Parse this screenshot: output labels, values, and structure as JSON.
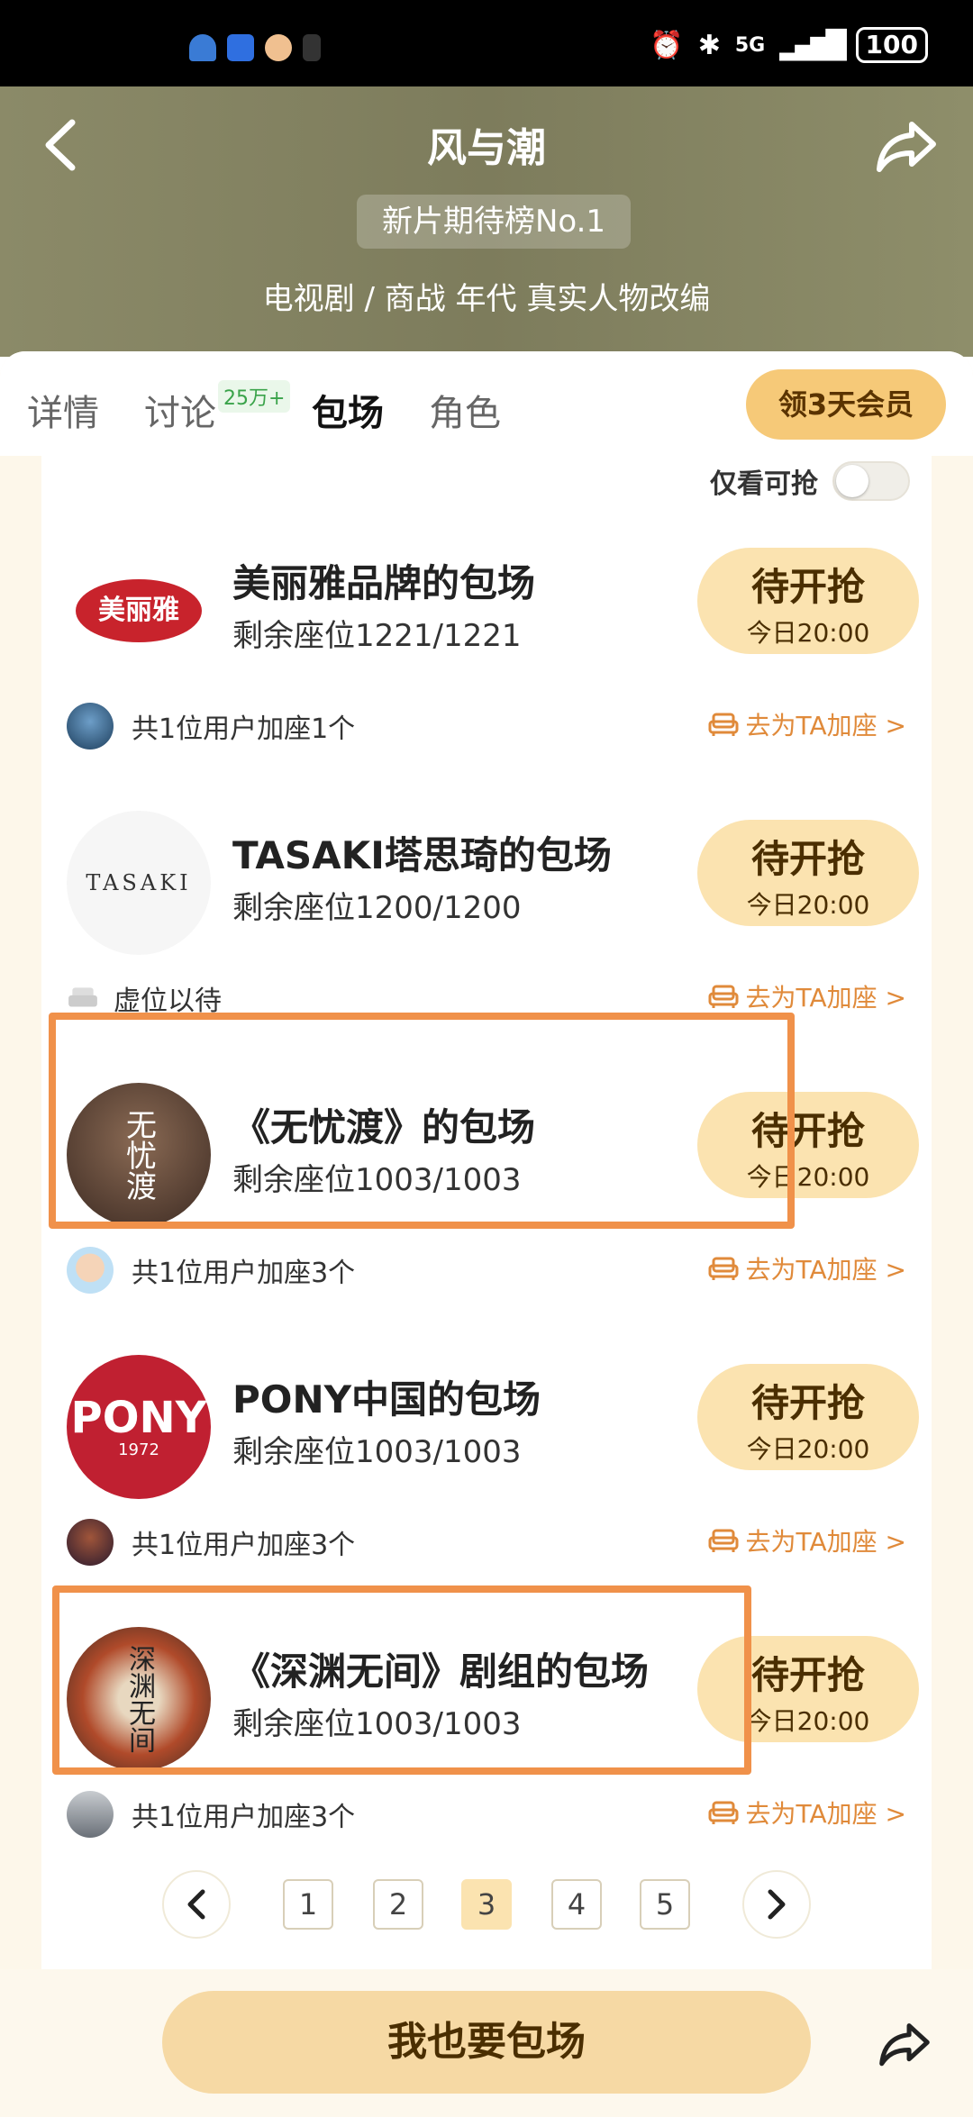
{
  "status_bar": {
    "network": "5G",
    "battery": "100"
  },
  "header": {
    "title": "风与潮",
    "rank_chip": "新片期待榜No.1",
    "genre": "电视剧 / 商战 年代 真实人物改编"
  },
  "tabs": [
    {
      "label": "详情",
      "active": false
    },
    {
      "label": "讨论",
      "badge": "25万+",
      "active": false
    },
    {
      "label": "包场",
      "active": true
    },
    {
      "label": "角色",
      "active": false
    }
  ],
  "vip_button": "领3天会员",
  "filter": {
    "label": "仅看可抢",
    "on": false
  },
  "items": [
    {
      "logo_text": "美丽雅",
      "title": "美丽雅品牌的包场",
      "seats": "剩余座位1221/1221",
      "button_main": "待开抢",
      "button_sub": "今日20:00",
      "footer": "共1位用户加座1个",
      "go_seat": "去为TA加座 >",
      "highlighted": false
    },
    {
      "logo_text": "TASAKI",
      "title": "TASAKI塔思琦的包场",
      "seats": "剩余座位1200/1200",
      "button_main": "待开抢",
      "button_sub": "今日20:00",
      "footer": "虚位以待",
      "go_seat": "去为TA加座 >",
      "highlighted": false
    },
    {
      "logo_text": "无忧渡",
      "title": "《无忧渡》的包场",
      "seats": "剩余座位1003/1003",
      "button_main": "待开抢",
      "button_sub": "今日20:00",
      "footer": "共1位用户加座3个",
      "go_seat": "去为TA加座 >",
      "highlighted": true
    },
    {
      "logo_text": "PONY",
      "logo_sub": "1972",
      "title": "PONY中国的包场",
      "seats": "剩余座位1003/1003",
      "button_main": "待开抢",
      "button_sub": "今日20:00",
      "footer": "共1位用户加座3个",
      "go_seat": "去为TA加座 >",
      "highlighted": false
    },
    {
      "logo_text": "深渊无间",
      "title": "《深渊无间》剧组的包场",
      "seats": "剩余座位1003/1003",
      "button_main": "待开抢",
      "button_sub": "今日20:00",
      "footer": "共1位用户加座3个",
      "go_seat": "去为TA加座 >",
      "highlighted": true
    }
  ],
  "pagination": {
    "pages": [
      "1",
      "2",
      "3",
      "4",
      "5"
    ],
    "current": "3"
  },
  "cta": "我也要包场",
  "colors": {
    "accent": "#f0914a",
    "button_bg": "#fbe3b0",
    "header_bg": "#8b8a68"
  }
}
